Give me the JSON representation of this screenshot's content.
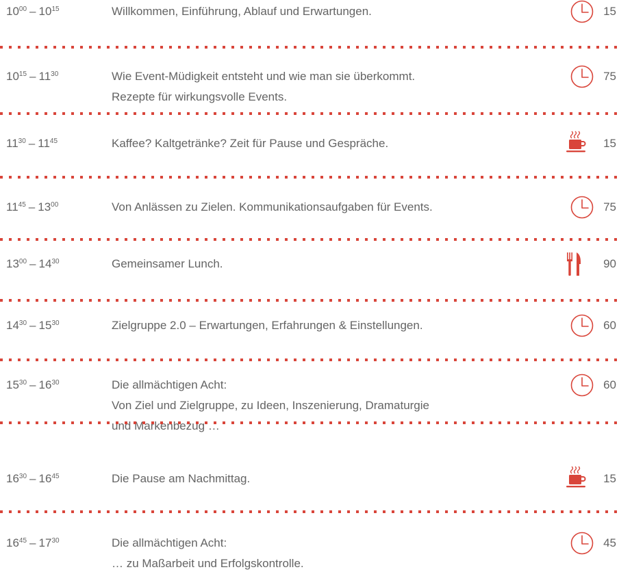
{
  "colors": {
    "accent": "#d9453a",
    "text": "#646464",
    "background": "#ffffff"
  },
  "rows": [
    {
      "start_h": "10",
      "start_m": "00",
      "end_h": "10",
      "end_m": "15",
      "lines": [
        "Willkommen, Einführung, Ablauf und Erwartungen."
      ],
      "icon": "clock-icon",
      "duration": "15"
    },
    {
      "start_h": "10",
      "start_m": "15",
      "end_h": "11",
      "end_m": "30",
      "lines": [
        "Wie Event-Müdigkeit entsteht und wie man sie überkommt.",
        "Rezepte für wirkungsvolle Events."
      ],
      "icon": "clock-icon",
      "duration": "75"
    },
    {
      "start_h": "11",
      "start_m": "30",
      "end_h": "11",
      "end_m": "45",
      "lines": [
        "Kaffee? Kaltgetränke? Zeit für Pause und Gespräche."
      ],
      "icon": "coffee-cup-icon",
      "duration": "15"
    },
    {
      "start_h": "11",
      "start_m": "45",
      "end_h": "13",
      "end_m": "00",
      "lines": [
        "Von Anlässen zu Zielen. Kommunikationsaufgaben für Events."
      ],
      "icon": "clock-icon",
      "duration": "75"
    },
    {
      "start_h": "13",
      "start_m": "00",
      "end_h": "14",
      "end_m": "30",
      "lines": [
        "Gemeinsamer Lunch."
      ],
      "icon": "fork-knife-icon",
      "duration": "90"
    },
    {
      "start_h": "14",
      "start_m": "30",
      "end_h": "15",
      "end_m": "30",
      "lines": [
        "Zielgruppe 2.0 – Erwartungen, Erfahrungen & Einstellungen."
      ],
      "icon": "clock-icon",
      "duration": "60"
    },
    {
      "start_h": "15",
      "start_m": "30",
      "end_h": "16",
      "end_m": "30",
      "lines": [
        "Die allmächtigen Acht:",
        "Von Ziel und Zielgruppe, zu Ideen, Inszenierung, Dramaturgie",
        "und Markenbezug …"
      ],
      "icon": "clock-icon",
      "duration": "60"
    },
    {
      "start_h": "16",
      "start_m": "30",
      "end_h": "16",
      "end_m": "45",
      "lines": [
        "Die Pause am Nachmittag."
      ],
      "icon": "coffee-cup-icon",
      "duration": "15"
    },
    {
      "start_h": "16",
      "start_m": "45",
      "end_h": "17",
      "end_m": "30",
      "lines": [
        "Die allmächtigen Acht:",
        "… zu Maßarbeit und Erfolgskontrolle."
      ],
      "icon": "clock-icon",
      "duration": "45"
    }
  ]
}
